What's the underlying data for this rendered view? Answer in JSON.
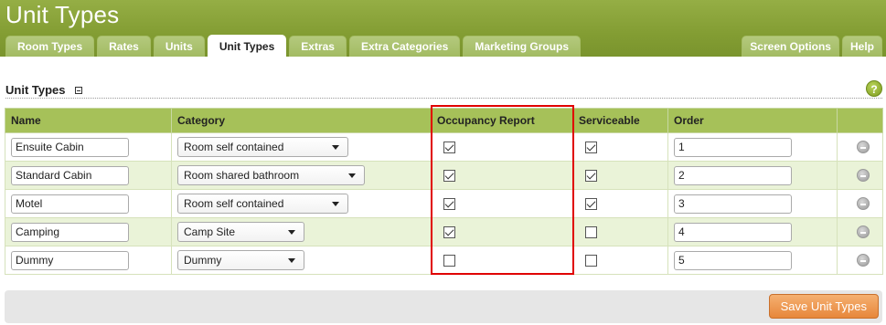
{
  "app": {
    "title": "Unit Types"
  },
  "tabs": [
    {
      "label": "Room Types",
      "active": false
    },
    {
      "label": "Rates",
      "active": false
    },
    {
      "label": "Units",
      "active": false
    },
    {
      "label": "Unit Types",
      "active": true
    },
    {
      "label": "Extras",
      "active": false
    },
    {
      "label": "Extra Categories",
      "active": false
    },
    {
      "label": "Marketing Groups",
      "active": false
    }
  ],
  "right_tabs": {
    "screen_options": "Screen Options",
    "help": "Help"
  },
  "section": {
    "title": "Unit Types",
    "help_glyph": "?"
  },
  "table": {
    "headers": {
      "name": "Name",
      "category": "Category",
      "occupancy": "Occupancy Report",
      "serviceable": "Serviceable",
      "order": "Order"
    },
    "rows": [
      {
        "name": "Ensuite Cabin",
        "category": "Room self contained",
        "occupancy": true,
        "serviceable": true,
        "order": "1"
      },
      {
        "name": "Standard Cabin",
        "category": "Room shared bathroom",
        "occupancy": true,
        "serviceable": true,
        "order": "2"
      },
      {
        "name": "Motel",
        "category": "Room self contained",
        "occupancy": true,
        "serviceable": true,
        "order": "3"
      },
      {
        "name": "Camping",
        "category": "Camp Site",
        "occupancy": true,
        "serviceable": false,
        "order": "4"
      },
      {
        "name": "Dummy",
        "category": "Dummy",
        "occupancy": false,
        "serviceable": false,
        "order": "5"
      }
    ]
  },
  "footer": {
    "save_label": "Save Unit Types"
  },
  "colors": {
    "header_green": "#839d33",
    "table_header_green": "#a6c159",
    "row_alt": "#eaf3d8",
    "highlight_red": "#e00000",
    "save_orange": "#e7873b"
  },
  "icons": {
    "collapse": "collapse-icon",
    "help": "help-icon",
    "delete": "remove-row-icon",
    "dropdown": "chevron-down-icon"
  }
}
